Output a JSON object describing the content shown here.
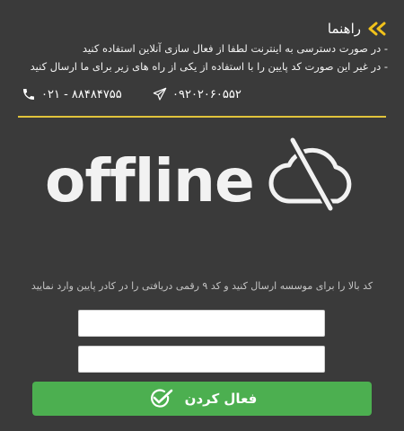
{
  "guide": {
    "title": "راهنما",
    "lines": [
      "- در صورت دسترسی به اینترنت لطفا از فعال سازی آنلاین استفاده کنید",
      "- در غیر این صورت کد پایین را با استفاده از یکی از راه های زیر برای ما ارسال کنید"
    ]
  },
  "contacts": {
    "telegram": "۰۹۲۰۲۰۶۰۵۵۲",
    "phone": "۰۲۱ - ۸۸۴۸۴۷۵۵"
  },
  "status": {
    "word": "offline"
  },
  "form": {
    "instruction": "کد بالا را برای موسسه ارسال کنید و کد ۹ رقمی دریافتی را در کادر پایین وارد نمایید",
    "input1_value": "",
    "input2_value": "",
    "activate_label": "فعال کردن"
  },
  "colors": {
    "background": "#3a3a3a",
    "accent": "#e0c33b",
    "button": "#4caf50"
  },
  "icons": [
    "double-arrow-icon",
    "telegram-icon",
    "phone-icon",
    "cloud-off-icon",
    "check-icon"
  ]
}
